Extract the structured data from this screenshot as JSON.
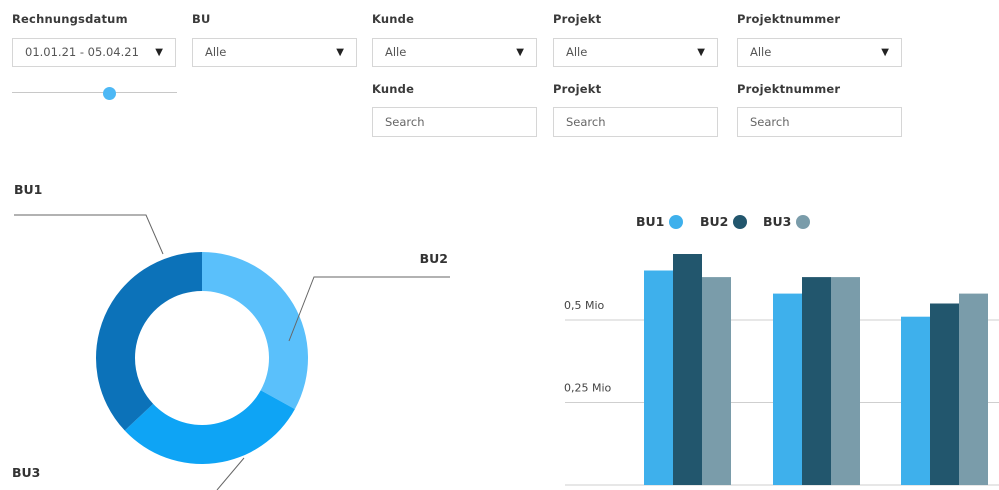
{
  "filters": {
    "rechnungsdatum": {
      "label": "Rechnungsdatum",
      "value": "01.01.21 - 05.04.21",
      "slider_fraction": 0.55
    },
    "bu": {
      "label": "BU",
      "value": "Alle"
    },
    "kunde": {
      "label": "Kunde",
      "value": "Alle",
      "search_label": "Kunde",
      "search_placeholder": "Search"
    },
    "projekt": {
      "label": "Projekt",
      "value": "Alle",
      "search_label": "Projekt",
      "search_placeholder": "Search"
    },
    "projektnummer": {
      "label": "Projektnummer",
      "value": "Alle",
      "search_label": "Projektnummer",
      "search_placeholder": "Search"
    }
  },
  "chart_data": [
    {
      "type": "pie",
      "title": "",
      "labels": [
        "BU1",
        "BU2",
        "BU3"
      ],
      "values": [
        37,
        33,
        30
      ],
      "colors": [
        "#0c72b9",
        "#5ac0fb",
        "#0ea4f5"
      ],
      "donut": true
    },
    {
      "type": "bar",
      "title": "",
      "xlabel": "",
      "ylabel": "",
      "categories": [
        "",
        "",
        ""
      ],
      "series": [
        {
          "name": "BU1",
          "values": [
            0.65,
            0.58,
            0.51
          ],
          "color": "#3eb0ec"
        },
        {
          "name": "BU2",
          "values": [
            0.7,
            0.63,
            0.55
          ],
          "color": "#22566d"
        },
        {
          "name": "BU3",
          "values": [
            0.63,
            0.63,
            0.58
          ],
          "color": "#7a9caa"
        }
      ],
      "yticks": [
        {
          "value": 0.25,
          "label": "0,25 Mio"
        },
        {
          "value": 0.5,
          "label": "0,5 Mio"
        }
      ],
      "ylim": [
        0,
        0.75
      ],
      "legend": "top",
      "grid": true
    }
  ]
}
